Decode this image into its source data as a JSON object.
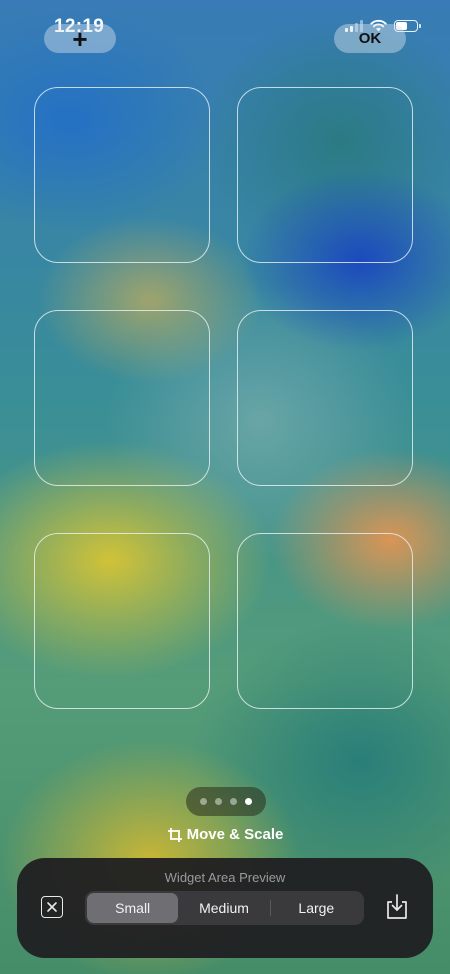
{
  "status_bar": {
    "time": "12:19",
    "signal_bars": 4,
    "signal_bars_active": 2,
    "wifi_icon": "wifi-icon",
    "battery_level": 0.5
  },
  "toolbar": {
    "add_label": "+",
    "ok_label": "OK"
  },
  "widget_slots": [
    {
      "id": "slot-1"
    },
    {
      "id": "slot-2"
    },
    {
      "id": "slot-3"
    },
    {
      "id": "slot-4"
    },
    {
      "id": "slot-5"
    },
    {
      "id": "slot-6"
    }
  ],
  "pager": {
    "page_count": 4,
    "current_page": 4
  },
  "move_scale": {
    "icon": "crop-icon",
    "label": "Move & Scale"
  },
  "preview_sheet": {
    "title": "Widget Area Preview",
    "close_icon": "close-icon",
    "download_icon": "download-icon",
    "sizes": [
      "Small",
      "Medium",
      "Large"
    ],
    "selected_size": "Small"
  },
  "colors": {
    "sheet_background": "#202022",
    "segment_selected": "#6e6e73",
    "segment_background": "#3a3a3d"
  }
}
